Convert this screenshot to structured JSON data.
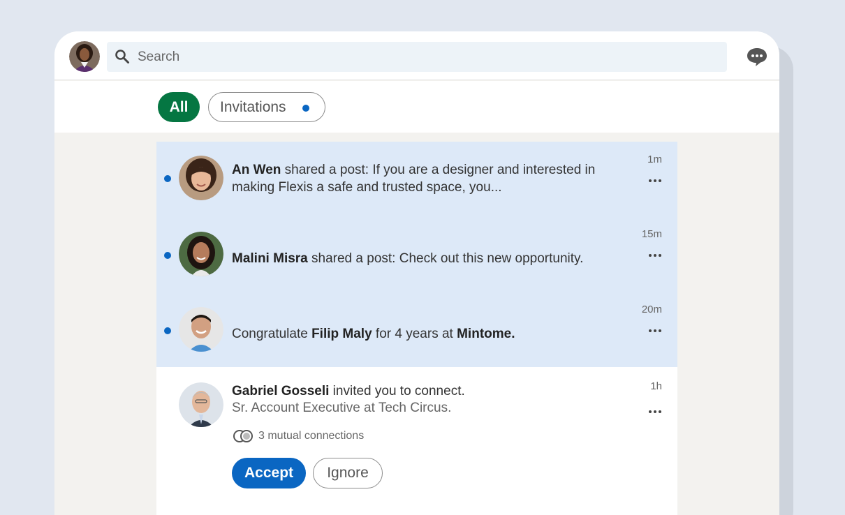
{
  "header": {
    "search_placeholder": "Search"
  },
  "filters": {
    "all_label": "All",
    "invitations_label": "Invitations"
  },
  "notifications": [
    {
      "name": "An Wen",
      "text": " shared a post: If you are a designer and interested in making Flexis a safe and trusted space, you...",
      "time": "1m",
      "unread": true
    },
    {
      "name": "Malini Misra",
      "text": " shared a post: Check out this new opportunity.",
      "time": "15m",
      "unread": true
    },
    {
      "prefix": "Congratulate ",
      "name": "Filip Maly",
      "middle": " for 4 years at ",
      "company": "Mintome.",
      "time": "20m",
      "unread": true
    }
  ],
  "invitation": {
    "name": "Gabriel Gosseli",
    "text": " invited you to connect.",
    "subtitle": "Sr. Account Executive at Tech Circus.",
    "mutual": "3 mutual connections",
    "time": "1h",
    "accept_label": "Accept",
    "ignore_label": "Ignore"
  },
  "colors": {
    "accent_green": "#057642",
    "brand_blue": "#0a66c2",
    "unread_bg": "#dde9f8"
  }
}
